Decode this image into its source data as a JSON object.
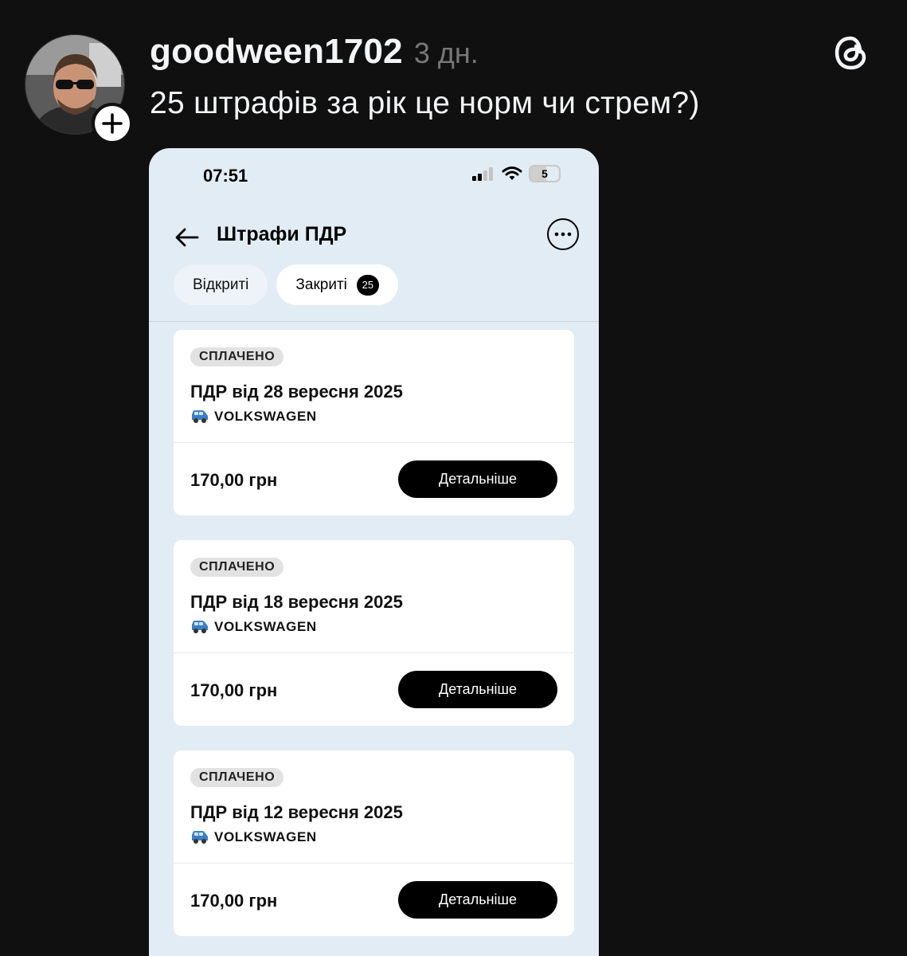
{
  "post": {
    "username": "goodween1702",
    "time": "3 дн.",
    "text": "25 штрафів за рік це норм чи стрем?)"
  },
  "phone": {
    "status_time": "07:51",
    "battery": "5",
    "title": "Штрафи ПДР",
    "tabs": [
      {
        "label": "Відкриті"
      },
      {
        "label": "Закриті",
        "count": "25"
      }
    ],
    "fines": [
      {
        "status": "СПЛАЧЕНО",
        "title": "ПДР від 28 вересня 2025",
        "car": "VOLKSWAGEN",
        "amount": "170,00 грн",
        "button": "Детальніше"
      },
      {
        "status": "СПЛАЧЕНО",
        "title": "ПДР від 18 вересня 2025",
        "car": "VOLKSWAGEN",
        "amount": "170,00 грн",
        "button": "Детальніше"
      },
      {
        "status": "СПЛАЧЕНО",
        "title": "ПДР від 12 вересня 2025",
        "car": "VOLKSWAGEN",
        "amount": "170,00 грн",
        "button": "Детальніше"
      }
    ]
  },
  "icons": {
    "follow": "plus-icon",
    "logo": "threads-logo-icon",
    "back": "arrow-left-icon",
    "more": "more-horizontal-icon",
    "car": "car-icon",
    "signal": "cellular-signal-icon",
    "wifi": "wifi-icon",
    "battery": "battery-icon"
  },
  "colors": {
    "background": "#101010",
    "phone_background": "#e2ecf4",
    "card": "#ffffff",
    "button": "#000000",
    "muted_text": "#777777"
  }
}
